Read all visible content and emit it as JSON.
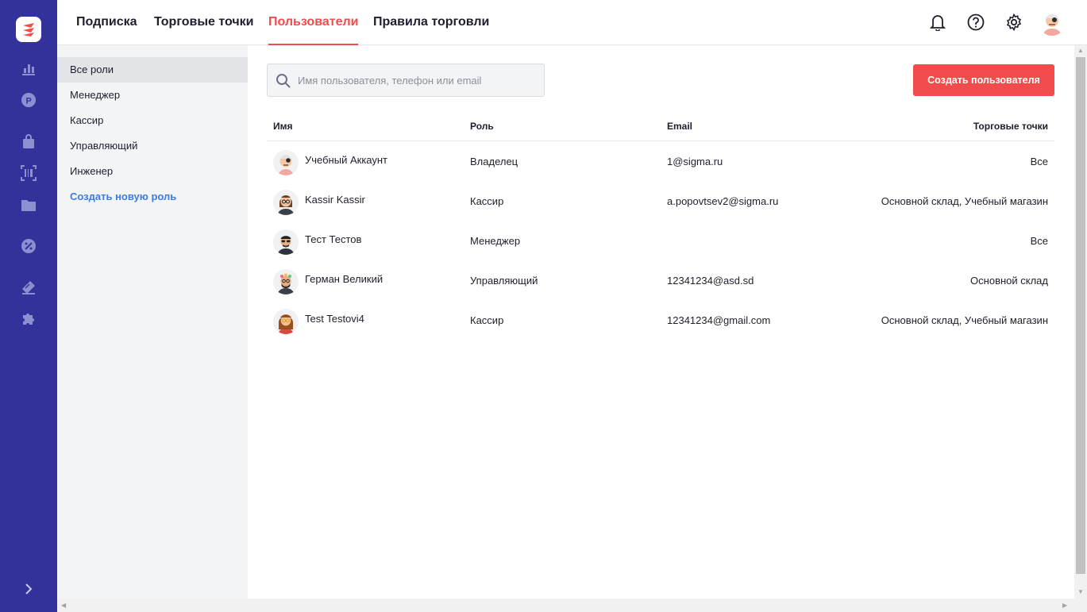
{
  "rail": {
    "bg_color": "#33319a",
    "logo": "app-logo",
    "items": [
      {
        "icon": "bar-chart-icon"
      },
      {
        "icon": "ruble-coin-icon"
      },
      {
        "icon": "shopping-bag-icon"
      },
      {
        "icon": "barcode-scan-icon"
      },
      {
        "icon": "folder-icon"
      },
      {
        "icon": "discount-badge-icon"
      },
      {
        "icon": "ticket-icon"
      },
      {
        "icon": "puzzle-icon"
      }
    ],
    "expand_icon": "chevron-right-icon"
  },
  "topnav": {
    "tabs": [
      {
        "label": "Подписка",
        "active": false
      },
      {
        "label": "Торговые точки",
        "active": false
      },
      {
        "label": "Пользователи",
        "active": true
      },
      {
        "label": "Правила торговли",
        "active": false
      }
    ],
    "accent_color": "#f24b4b",
    "icons": [
      "bell-icon",
      "help-circle-icon",
      "gear-icon",
      "user-avatar"
    ]
  },
  "roles": {
    "items": [
      {
        "label": "Все роли",
        "selected": true
      },
      {
        "label": "Менеджер",
        "selected": false
      },
      {
        "label": "Кассир",
        "selected": false
      },
      {
        "label": "Управляющий",
        "selected": false
      },
      {
        "label": "Инженер",
        "selected": false
      }
    ],
    "create_label": "Создать новую роль"
  },
  "search": {
    "placeholder": "Имя пользователя, телефон или email",
    "value": ""
  },
  "create_button": {
    "label": "Создать пользователя"
  },
  "table": {
    "columns": {
      "name": "Имя",
      "role": "Роль",
      "email": "Email",
      "stores": "Торговые точки"
    },
    "rows": [
      {
        "name": "Учебный Аккаунт",
        "role": "Владелец",
        "email": "1@sigma.ru",
        "stores": "Все",
        "avatar": "pirate-avatar"
      },
      {
        "name": "Kassir Kassir",
        "role": "Кассир",
        "email": "a.popovtsev2@sigma.ru",
        "stores": "Основной склад, Учебный магазин",
        "avatar": "glasses-woman-avatar"
      },
      {
        "name": "Тест Тестов",
        "role": "Менеджер",
        "email": "",
        "stores": "Все",
        "avatar": "sunglasses-man-avatar"
      },
      {
        "name": "Герман Великий",
        "role": "Управляющий",
        "email": "12341234@asd.sd",
        "stores": "Основной склад",
        "avatar": "flower-crown-avatar"
      },
      {
        "name": "Test Testovi4",
        "role": "Кассир",
        "email": "12341234@gmail.com",
        "stores": "Основной склад, Учебный магазин",
        "avatar": "curly-hair-woman-avatar"
      }
    ]
  }
}
